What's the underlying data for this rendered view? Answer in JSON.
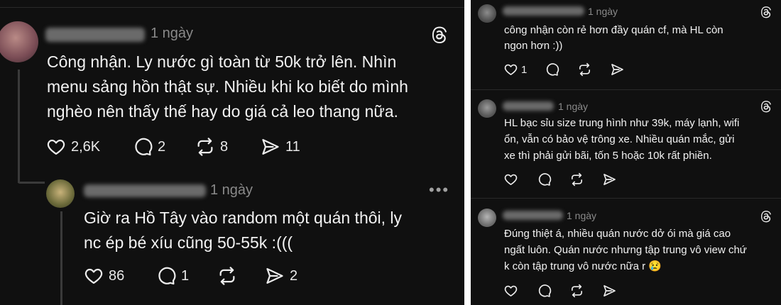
{
  "left": {
    "post": {
      "time": "1 ngày",
      "text_lines": [
        "Công nhận. Ly nước gì toàn từ 50k trở lên. Nhìn",
        "menu sảng hồn thật sự. Nhiều khi ko biết do mình",
        "nghèo nên thấy thế hay do giá cả leo thang nữa."
      ],
      "likes": "2,6K",
      "replies": "2",
      "reposts": "8",
      "shares": "11"
    },
    "reply": {
      "time": "1 ngày",
      "text_lines": [
        "Giờ ra Hồ Tây vào random một quán thôi, ly",
        "nc ép bé xíu cũng 50-55k :((("
      ],
      "likes": "86",
      "replies": "1",
      "shares": "2"
    }
  },
  "right": {
    "comments": [
      {
        "time": "1 ngày",
        "text_lines": [
          "công nhận còn rẻ hơn đầy quán cf, mà HL còn",
          "ngon hơn :))"
        ],
        "likes": "1"
      },
      {
        "time": "1 ngày",
        "text_lines": [
          "HL bạc sỉu size trung hình như 39k, máy lạnh, wifi",
          "ổn, vẫn có bảo vệ trông xe. Nhiều quán mắc, gửi",
          "xe thì phải gửi bãi, tốn 5 hoặc 10k rất phiền."
        ]
      },
      {
        "time": "1 ngày",
        "text_lines": [
          "Đúng thiệt á, nhiều quán nước dở ói mà giá cao",
          "ngất luôn. Quán nước nhưng tập trung vô view chứ",
          "k còn tập trung vô nước nữa r 😢"
        ]
      }
    ]
  },
  "colors": {
    "background": "#101010",
    "text": "#f2f2f2",
    "muted": "#8a8a8a",
    "divider": "#2a2a2a"
  },
  "icons": [
    "heart-icon",
    "reply-icon",
    "repost-icon",
    "share-icon",
    "threads-logo-icon",
    "more-icon"
  ]
}
